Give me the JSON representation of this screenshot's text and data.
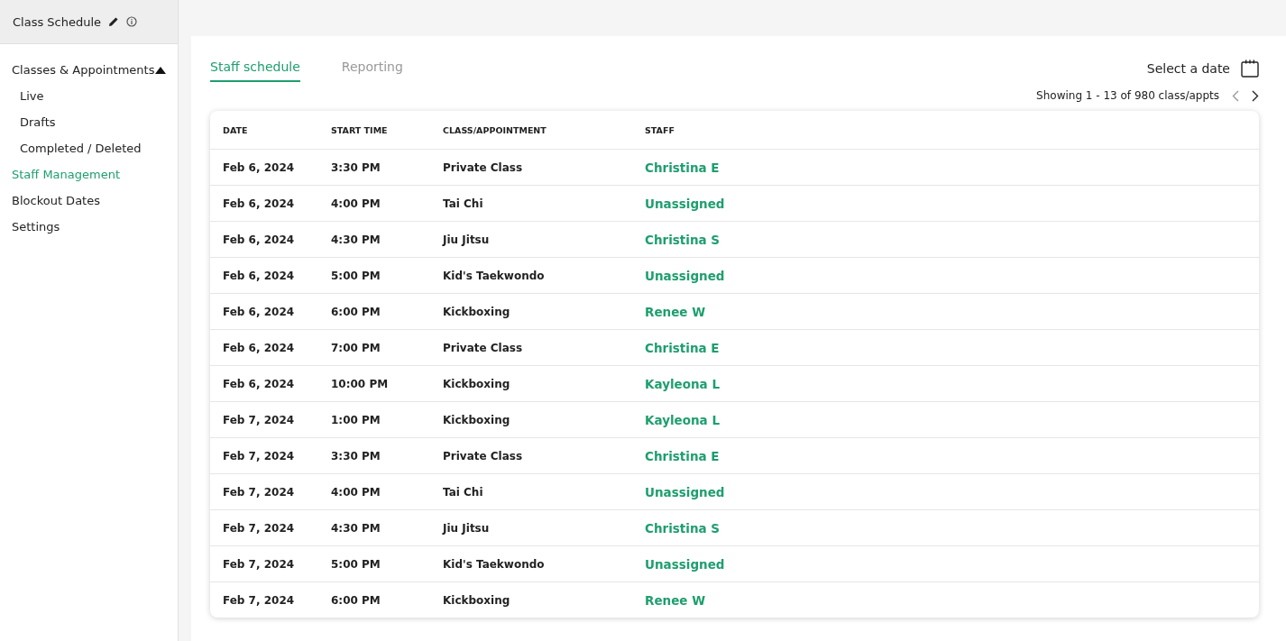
{
  "sidebar": {
    "title": "Class Schedule",
    "items": [
      {
        "label": "Classes & Appointments",
        "selected": false,
        "expanded": true,
        "children": [
          {
            "label": "Live",
            "selected": false
          },
          {
            "label": "Drafts",
            "selected": false
          },
          {
            "label": "Completed / Deleted",
            "selected": false
          }
        ]
      },
      {
        "label": "Staff Management",
        "selected": true
      },
      {
        "label": "Blockout Dates",
        "selected": false
      },
      {
        "label": "Settings",
        "selected": false
      }
    ]
  },
  "tabs": [
    {
      "label": "Staff schedule",
      "selected": true
    },
    {
      "label": "Reporting",
      "selected": false
    }
  ],
  "date_picker": {
    "label": "Select a date"
  },
  "pagination": {
    "summary": "Showing 1 - 13 of 980 class/appts"
  },
  "table": {
    "columns": [
      "DATE",
      "START TIME",
      "CLASS/APPOINTMENT",
      "STAFF"
    ],
    "rows": [
      [
        "Feb 6, 2024",
        "3:30 PM",
        "Private Class",
        "Christina E"
      ],
      [
        "Feb 6, 2024",
        "4:00 PM",
        "Tai Chi",
        "Unassigned"
      ],
      [
        "Feb 6, 2024",
        "4:30 PM",
        "Jiu Jitsu",
        "Christina S"
      ],
      [
        "Feb 6, 2024",
        "5:00 PM",
        "Kid's Taekwondo",
        "Unassigned"
      ],
      [
        "Feb 6, 2024",
        "6:00 PM",
        "Kickboxing",
        "Renee W"
      ],
      [
        "Feb 6, 2024",
        "7:00 PM",
        "Private Class",
        "Christina E"
      ],
      [
        "Feb 6, 2024",
        "10:00 PM",
        "Kickboxing",
        "Kayleona L"
      ],
      [
        "Feb 7, 2024",
        "1:00 PM",
        "Kickboxing",
        "Kayleona L"
      ],
      [
        "Feb 7, 2024",
        "3:30 PM",
        "Private Class",
        "Christina E"
      ],
      [
        "Feb 7, 2024",
        "4:00 PM",
        "Tai Chi",
        "Unassigned"
      ],
      [
        "Feb 7, 2024",
        "4:30 PM",
        "Jiu Jitsu",
        "Christina S"
      ],
      [
        "Feb 7, 2024",
        "5:00 PM",
        "Kid's Taekwondo",
        "Unassigned"
      ],
      [
        "Feb 7, 2024",
        "6:00 PM",
        "Kickboxing",
        "Renee W"
      ]
    ]
  }
}
